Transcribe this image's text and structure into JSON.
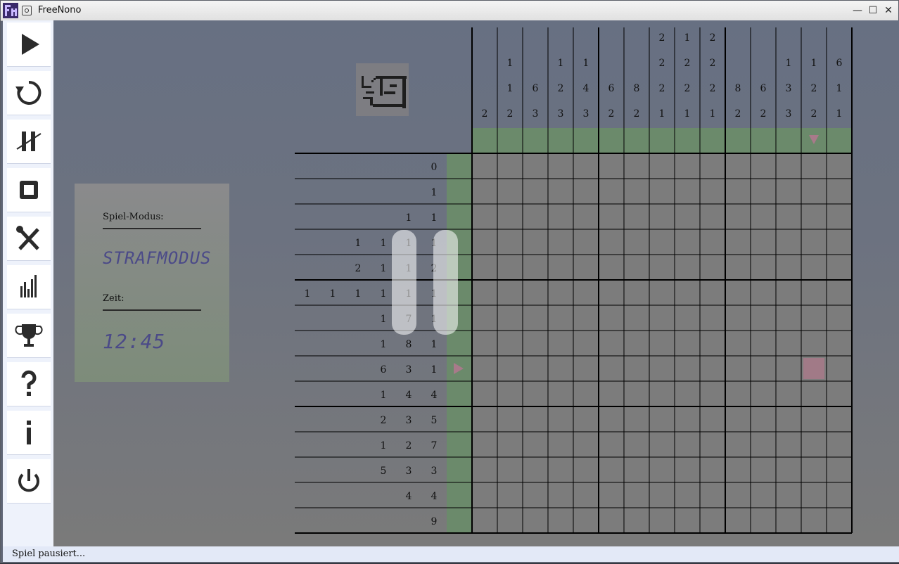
{
  "window": {
    "title": "FreeNono"
  },
  "toolbar": [
    {
      "name": "play-button",
      "icon": "play-icon"
    },
    {
      "name": "restart-button",
      "icon": "restart-icon"
    },
    {
      "name": "pause-button",
      "icon": "pause-icon"
    },
    {
      "name": "stop-button",
      "icon": "stop-icon"
    },
    {
      "name": "settings-button",
      "icon": "tools-icon"
    },
    {
      "name": "statistics-button",
      "icon": "bar-chart-icon"
    },
    {
      "name": "highscore-button",
      "icon": "trophy-icon"
    },
    {
      "name": "help-button",
      "icon": "question-icon"
    },
    {
      "name": "about-button",
      "icon": "info-icon"
    },
    {
      "name": "quit-button",
      "icon": "power-icon"
    }
  ],
  "info": {
    "mode_label": "Spiel-Modus:",
    "mode_value": "STRAFMODUS",
    "time_label": "Zeit:",
    "time_value": "12:45"
  },
  "status": {
    "text": "Spiel pausiert..."
  },
  "puzzle": {
    "columns": 15,
    "rows": 15,
    "column_clues": [
      [
        "2"
      ],
      [
        "1",
        "1",
        "2"
      ],
      [
        "6",
        "3"
      ],
      [
        "1",
        "2",
        "3"
      ],
      [
        "1",
        "4",
        "3"
      ],
      [
        "6",
        "2"
      ],
      [
        "8",
        "2"
      ],
      [
        "2",
        "2",
        "2",
        "1"
      ],
      [
        "1",
        "2",
        "2",
        "1"
      ],
      [
        "2",
        "2",
        "2",
        "1"
      ],
      [
        "8",
        "2"
      ],
      [
        "6",
        "2"
      ],
      [
        "1",
        "3",
        "3"
      ],
      [
        "1",
        "2",
        "2"
      ],
      [
        "6",
        "1",
        "1"
      ]
    ],
    "row_clues": [
      [
        "0"
      ],
      [
        "1"
      ],
      [
        "1",
        "1"
      ],
      [
        "1",
        "1",
        "1",
        "1"
      ],
      [
        "2",
        "1",
        "1",
        "2"
      ],
      [
        "1",
        "1",
        "1",
        "1",
        "1",
        "1"
      ],
      [
        "1",
        "7",
        "1"
      ],
      [
        "1",
        "8",
        "1"
      ],
      [
        "6",
        "3",
        "1"
      ],
      [
        "1",
        "4",
        "4"
      ],
      [
        "2",
        "3",
        "5"
      ],
      [
        "1",
        "2",
        "7"
      ],
      [
        "5",
        "3",
        "3"
      ],
      [
        "4",
        "4"
      ],
      [
        "9"
      ]
    ],
    "marked_cell": {
      "row": 8,
      "col": 13
    },
    "cursor_column": 13,
    "cursor_row": 8,
    "colors": {
      "cell": "#7c7c7c",
      "highlight": "#6b8a6b",
      "marker": "#a87a8a"
    }
  }
}
